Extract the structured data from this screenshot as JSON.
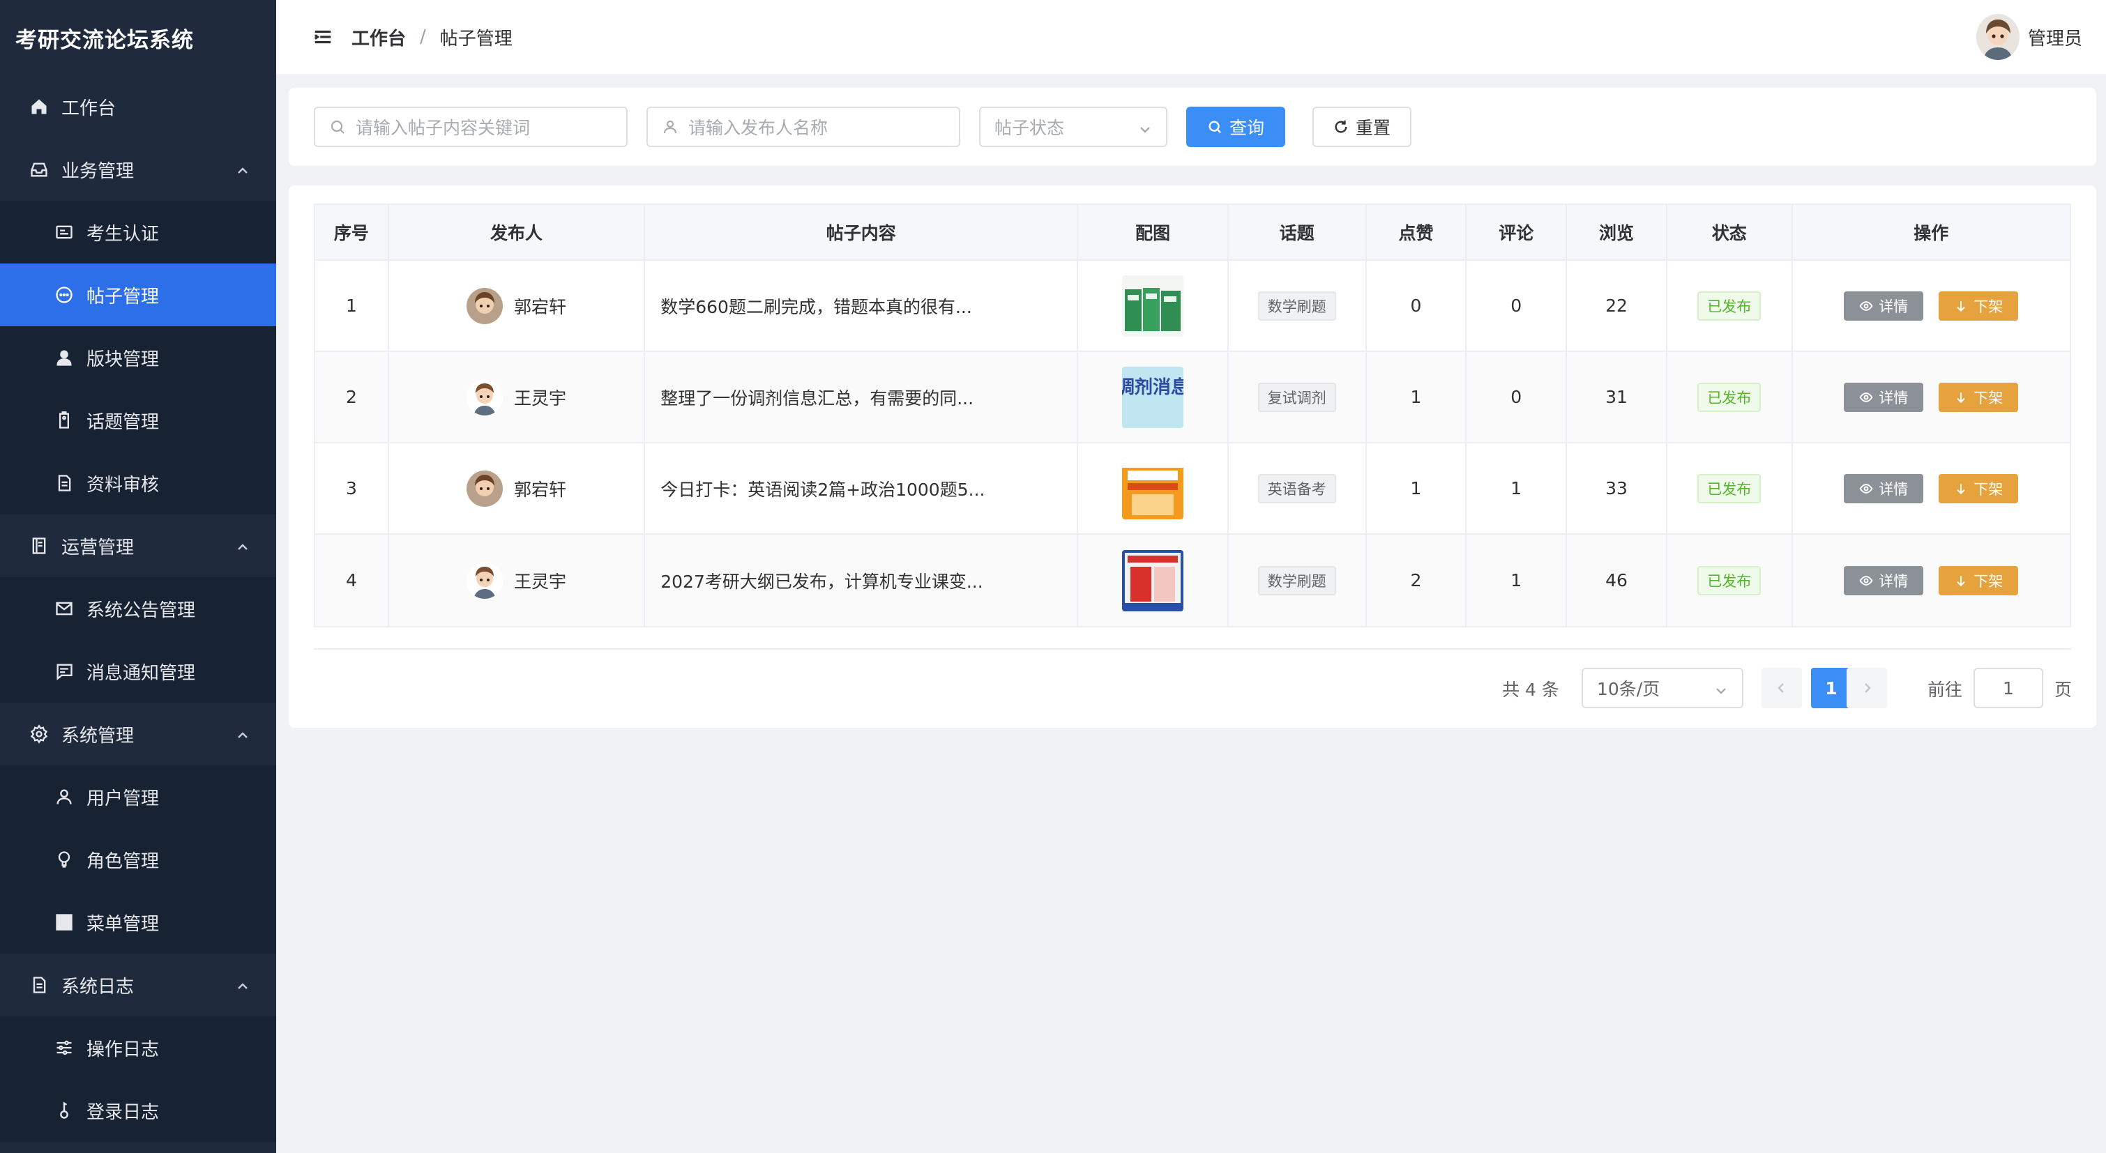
{
  "app": {
    "title": "考研交流论坛系统"
  },
  "sidebar": {
    "items": [
      {
        "label": "工作台",
        "icon": "home-icon"
      },
      {
        "label": "业务管理",
        "icon": "inbox-icon"
      },
      {
        "label": "考生认证",
        "icon": "id-card-icon"
      },
      {
        "label": "帖子管理",
        "icon": "chat-icon"
      },
      {
        "label": "版块管理",
        "icon": "user-icon"
      },
      {
        "label": "话题管理",
        "icon": "tag-icon"
      },
      {
        "label": "资料审核",
        "icon": "document-icon"
      },
      {
        "label": "运营管理",
        "icon": "notebook-icon"
      },
      {
        "label": "系统公告管理",
        "icon": "mail-icon"
      },
      {
        "label": "消息通知管理",
        "icon": "message-icon"
      },
      {
        "label": "系统管理",
        "icon": "gear-icon"
      },
      {
        "label": "用户管理",
        "icon": "user-icon"
      },
      {
        "label": "角色管理",
        "icon": "bulb-icon"
      },
      {
        "label": "菜单管理",
        "icon": "grid-icon"
      },
      {
        "label": "系统日志",
        "icon": "document-icon"
      },
      {
        "label": "操作日志",
        "icon": "sliders-icon"
      },
      {
        "label": "登录日志",
        "icon": "key-icon"
      }
    ]
  },
  "header": {
    "breadcrumb_home": "工作台",
    "breadcrumb_sep": "/",
    "breadcrumb_current": "帖子管理",
    "user_name": "管理员"
  },
  "search": {
    "keyword_placeholder": "请输入帖子内容关键词",
    "publisher_placeholder": "请输入发布人名称",
    "status_placeholder": "帖子状态",
    "query_label": "查询",
    "reset_label": "重置"
  },
  "table": {
    "headers": [
      "序号",
      "发布人",
      "帖子内容",
      "配图",
      "话题",
      "点赞",
      "评论",
      "浏览",
      "状态",
      "操作"
    ],
    "rows": [
      {
        "index": "1",
        "publisher": "郭宕轩",
        "content": "数学660题二刷完成，错题本真的很有...",
        "topic": "数学刷题",
        "likes": "0",
        "comments": "0",
        "views": "22",
        "status": "已发布"
      },
      {
        "index": "2",
        "publisher": "王灵宇",
        "content": "整理了一份调剂信息汇总，有需要的同...",
        "topic": "复试调剂",
        "likes": "1",
        "comments": "0",
        "views": "31",
        "status": "已发布"
      },
      {
        "index": "3",
        "publisher": "郭宕轩",
        "content": "今日打卡：英语阅读2篇+政治1000题5...",
        "topic": "英语备考",
        "likes": "1",
        "comments": "1",
        "views": "33",
        "status": "已发布"
      },
      {
        "index": "4",
        "publisher": "王灵宇",
        "content": "2027考研大纲已发布，计算机专业课变...",
        "topic": "数学刷题",
        "likes": "2",
        "comments": "1",
        "views": "46",
        "status": "已发布"
      }
    ],
    "detail_label": "详情",
    "offline_label": "下架",
    "thumb_text_2": "调剂消息"
  },
  "pagination": {
    "total": "共 4 条",
    "page_size": "10条/页",
    "current_page": "1",
    "goto_label": "前往",
    "goto_value": "1",
    "page_suffix": "页"
  },
  "colors": {
    "sidebar_bg": "#1f2a3c",
    "active": "#2c6fe8",
    "primary": "#3a8ef6",
    "warning": "#e6a23c",
    "success": "#52b52c"
  }
}
